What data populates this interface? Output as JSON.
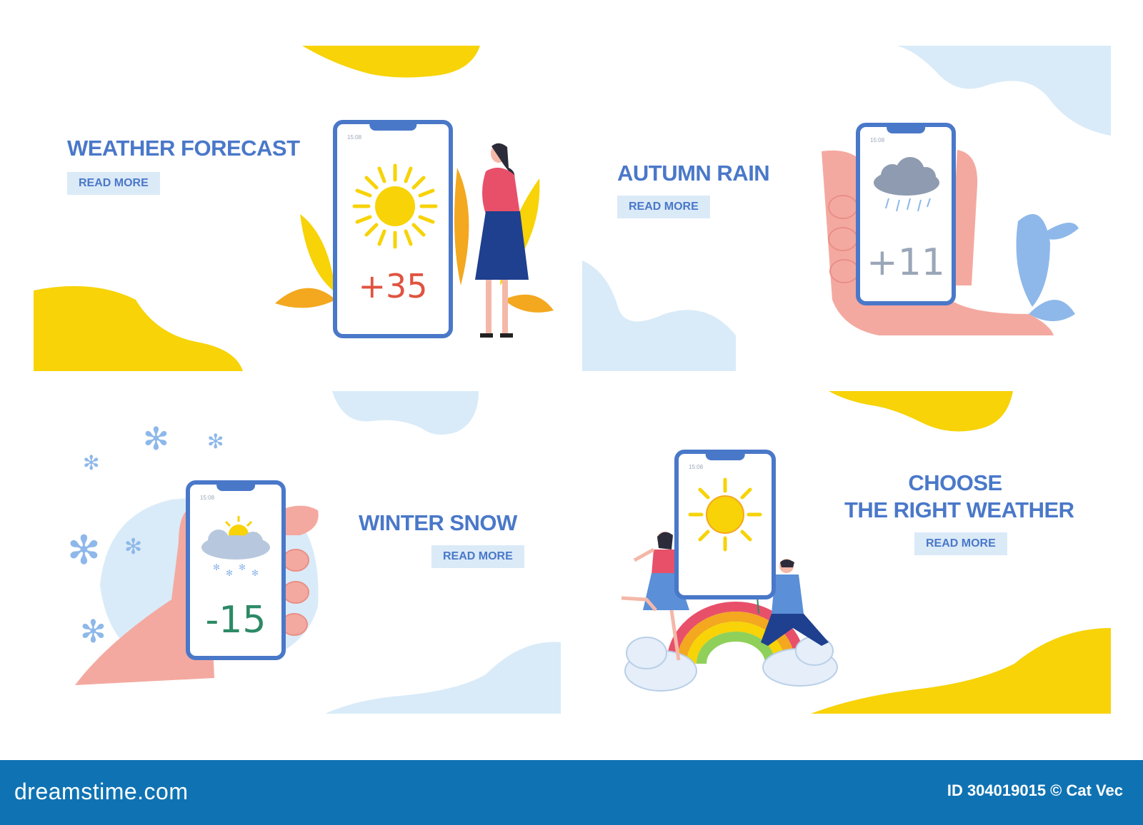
{
  "panels": [
    {
      "id": "weather-forecast",
      "title": "WEATHER FORECAST",
      "button_label": "READ MORE",
      "phone_time": "15:08",
      "temperature": "+35",
      "weather": "sun-icon"
    },
    {
      "id": "autumn-rain",
      "title": "AUTUMN RAIN",
      "button_label": "READ MORE",
      "phone_time": "15:08",
      "temperature": "+11",
      "weather": "rain-cloud-icon"
    },
    {
      "id": "winter-snow",
      "title": "WINTER SNOW",
      "button_label": "READ MORE",
      "phone_time": "15:08",
      "temperature": "-15",
      "weather": "snow-cloud-icon"
    },
    {
      "id": "choose-weather",
      "title_line1": "CHOOSE",
      "title_line2": "THE RIGHT WEATHER",
      "button_label": "READ MORE",
      "phone_time": "15:08",
      "weather": "sun-icon"
    }
  ],
  "footer": {
    "brand": "dreamstime.com",
    "image_id": "ID 304019015 © Cat Vec"
  },
  "colors": {
    "accent_blue": "#4a78c9",
    "button_bg": "#dbeaf7",
    "yellow": "#f7d308",
    "pale_blue": "#d9ebf8",
    "footer_bg": "#0f73b3",
    "temp_hot": "#e0533f",
    "temp_mild": "#9aa6b8",
    "temp_cold": "#2c8a66"
  }
}
